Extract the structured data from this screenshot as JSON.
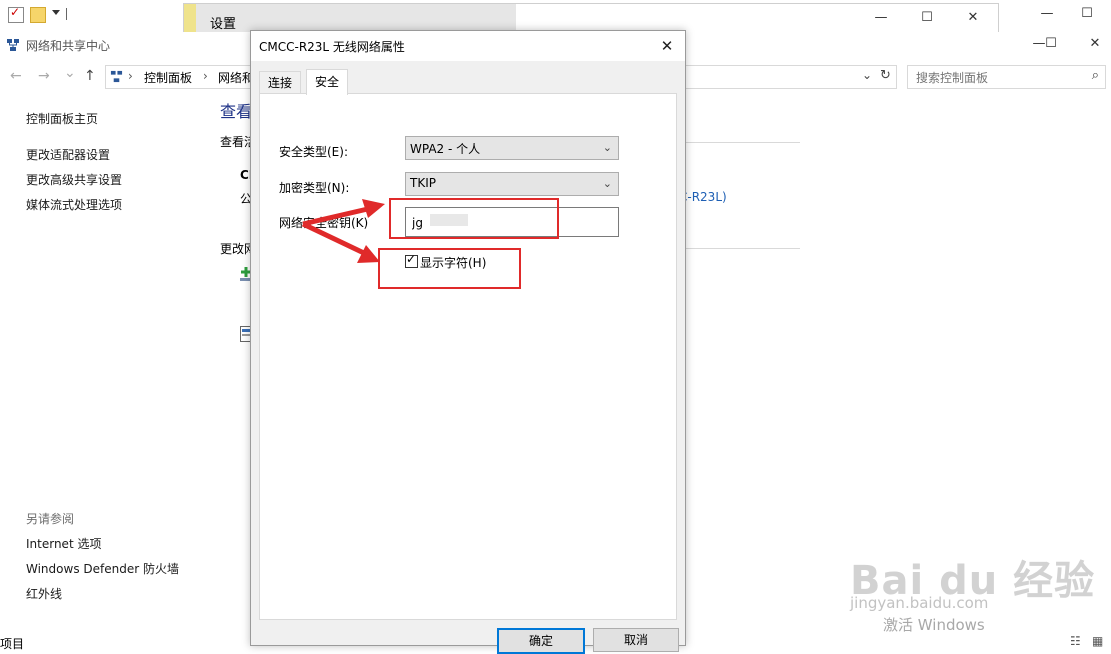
{
  "settings_window": {
    "title": "设置",
    "minimize": "—",
    "maximize": "☐",
    "close": "✕"
  },
  "control_panel": {
    "title": "网络和共享中心",
    "window_controls": {
      "minimize": "—",
      "maximize": "☐",
      "close": "✕"
    },
    "nav": {
      "back": "←",
      "forward": "→",
      "recent": "⌄",
      "up": "↑"
    },
    "breadcrumb": [
      "控制面板",
      "网络和"
    ],
    "breadcrumb_sep": "›",
    "refresh": "↻",
    "search_placeholder": "搜索控制面板",
    "sidebar": {
      "home": "控制面板主页",
      "items": [
        "更改适配器设置",
        "更改高级共享设置",
        "媒体流式处理选项"
      ],
      "see_also_heading": "另请参阅",
      "see_also": [
        "Internet 选项",
        "Windows Defender 防火墙",
        "红外线"
      ]
    },
    "main_fragments": {
      "heading": "查看",
      "sub": "查看活",
      "cm": "CI",
      "pub": "公",
      "change": "更改网",
      "conn": "C-R23L)"
    },
    "status_fragment": "项目"
  },
  "dialog": {
    "title": "CMCC-R23L 无线网络属性",
    "close": "✕",
    "tabs": [
      "连接",
      "安全"
    ],
    "active_tab": "安全",
    "security_type_label": "安全类型(E):",
    "security_type_value": "WPA2 - 个人",
    "encryption_type_label": "加密类型(N):",
    "encryption_type_value": "TKIP",
    "network_key_label": "网络安全密钥(K)",
    "network_key_value": "jg",
    "show_chars_label": "显示字符(H)",
    "show_chars_checked": true,
    "ok_button": "确定",
    "cancel_button": "取消"
  },
  "annotation_color": "#e02a2a",
  "watermark": {
    "brand": "Bai du 经验",
    "url": "jingyan.baidu.com",
    "activate": "激活 Windows"
  }
}
